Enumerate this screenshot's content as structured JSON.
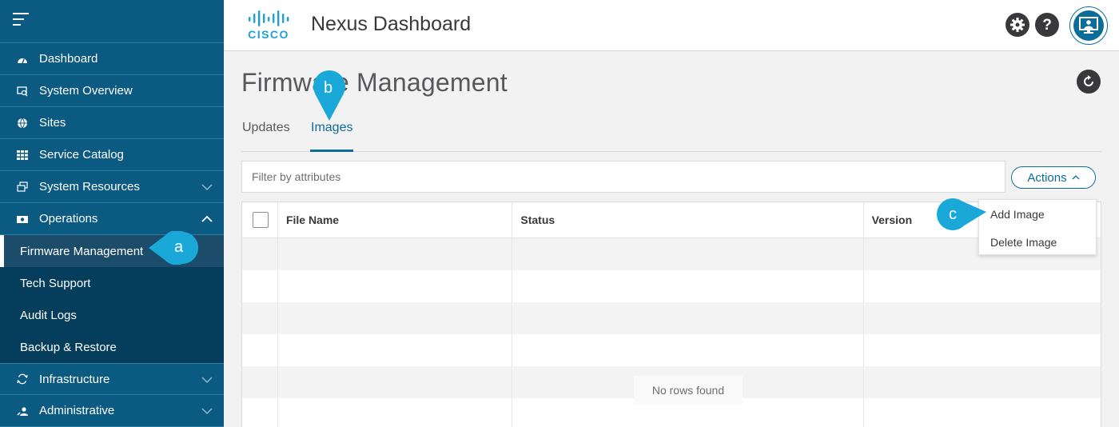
{
  "header": {
    "logo_text": "CISCO",
    "app_title": "Nexus Dashboard"
  },
  "sidebar": {
    "items": [
      {
        "label": "Dashboard",
        "icon": "dashboard-icon"
      },
      {
        "label": "System Overview",
        "icon": "system-overview-icon"
      },
      {
        "label": "Sites",
        "icon": "globe-icon"
      },
      {
        "label": "Service Catalog",
        "icon": "grid-icon"
      },
      {
        "label": "System Resources",
        "icon": "resources-icon",
        "expandable": true
      },
      {
        "label": "Operations",
        "icon": "operations-icon",
        "expanded": true,
        "children": [
          {
            "label": "Firmware Management",
            "active": true
          },
          {
            "label": "Tech Support"
          },
          {
            "label": "Audit Logs"
          },
          {
            "label": "Backup & Restore"
          }
        ]
      },
      {
        "label": "Infrastructure",
        "icon": "infrastructure-icon",
        "expandable": true
      },
      {
        "label": "Administrative",
        "icon": "administrative-icon",
        "expandable": true
      }
    ]
  },
  "main": {
    "title": "Firmware Management",
    "tabs": [
      {
        "label": "Updates",
        "active": false
      },
      {
        "label": "Images",
        "active": true
      }
    ],
    "filter_placeholder": "Filter by attributes",
    "actions_label": "Actions",
    "table": {
      "columns": [
        "File Name",
        "Status",
        "Version"
      ],
      "empty_text": "No rows found"
    },
    "actions_menu": [
      "Add Image",
      "Delete Image"
    ]
  },
  "callouts": {
    "a": "a",
    "b": "b",
    "c": "c"
  },
  "colors": {
    "sidebar": "#0b5a82",
    "sidebar_sub": "#053e5d",
    "accent": "#0d6c98",
    "callout": "#1aa8d8"
  }
}
